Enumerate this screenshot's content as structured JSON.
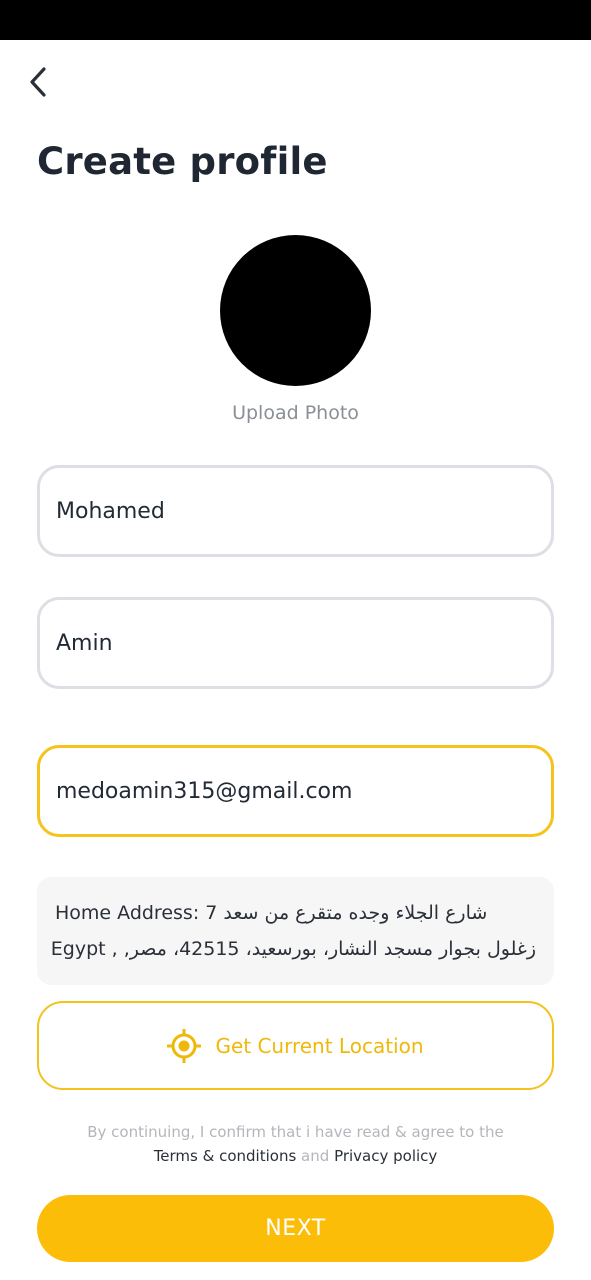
{
  "header": {
    "title": "Create profile"
  },
  "photo": {
    "upload_label": "Upload Photo"
  },
  "form": {
    "first_name": "Mohamed",
    "last_name": "Amin",
    "email": "medoamin315@gmail.com"
  },
  "address": {
    "line1": "Home Address: 7 شارع الجلاء وجده متقرع من سعد",
    "line2": "زغلول بجوار مسجد النشار، بورسعيد، 42515، مصر, , Egypt"
  },
  "location_button": {
    "label": "Get Current Location"
  },
  "terms": {
    "prefix": "By continuing, I confirm that i have read & agree to the",
    "terms_link": "Terms & conditions",
    "conjunction": "and",
    "privacy_link": "Privacy policy"
  },
  "next_button": {
    "label": "NEXT"
  },
  "colors": {
    "accent": "#FBBD08",
    "focus_border": "#F6C21C"
  }
}
